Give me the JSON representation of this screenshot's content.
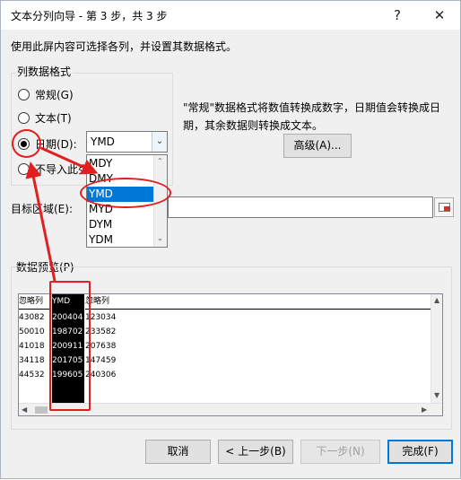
{
  "window": {
    "title": "文本分列向导 - 第 3 步，共 3 步",
    "help_icon": "?",
    "close_icon": "✕"
  },
  "instruction": "使用此屏内容可选择各列，并设置其数据格式。",
  "format_group": {
    "legend": "列数据格式",
    "options": [
      {
        "label": "常规(G)",
        "selected": false
      },
      {
        "label": "文本(T)",
        "selected": false
      },
      {
        "label": "日期(D):",
        "selected": true
      },
      {
        "label": "不导入此列",
        "selected": false
      }
    ],
    "date_select": {
      "value": "YMD",
      "options": [
        "MDY",
        "DMY",
        "YMD",
        "MYD",
        "DYM",
        "YDM"
      ],
      "highlighted": "YMD"
    }
  },
  "description": "\"常规\"数据格式将数值转换成数字，日期值会转换成日期，其余数据则转换成文本。",
  "advanced_button": "高级(A)...",
  "target_label": "目标区域(E):",
  "target_value": "$",
  "preview": {
    "legend": "数据预览(P)",
    "headers": [
      "忽略列",
      "YMD",
      "忽略列"
    ],
    "rows": [
      [
        "43082",
        "200404",
        "123034"
      ],
      [
        "50010",
        "198702",
        "233582"
      ],
      [
        "41018",
        "200911",
        "207638"
      ],
      [
        "34118",
        "201705",
        "147459"
      ],
      [
        "44532",
        "199605",
        "240306"
      ]
    ]
  },
  "buttons": {
    "cancel": "取消",
    "back": "< 上一步(B)",
    "next": "下一步(N)",
    "finish": "完成(F)"
  },
  "colors": {
    "annotation": "#e02020",
    "selection": "#0078d7"
  }
}
